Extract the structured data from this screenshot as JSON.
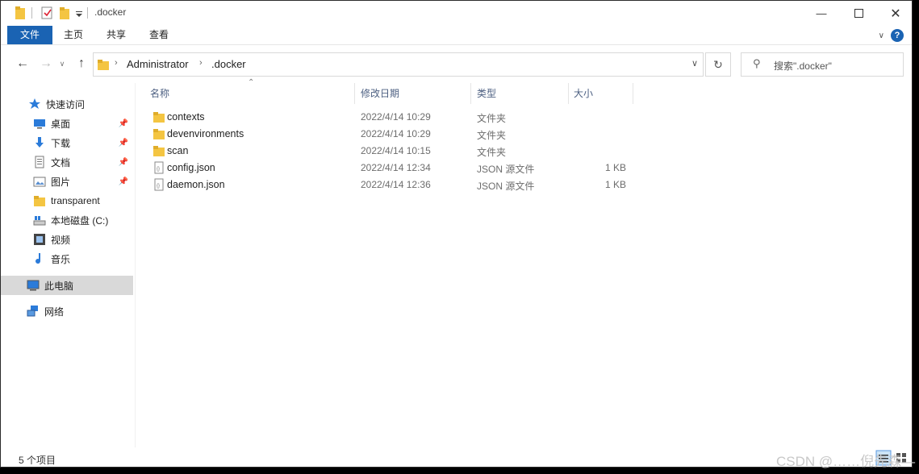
{
  "window": {
    "title": ".docker"
  },
  "ribbon": {
    "tabs": [
      "文件",
      "主页",
      "共享",
      "查看"
    ],
    "help_label": "?"
  },
  "address": {
    "segments": [
      "Administrator",
      ".docker"
    ]
  },
  "search": {
    "placeholder": "搜索\".docker\""
  },
  "sidebar": {
    "items": [
      {
        "label": "快速访问",
        "icon": "star-icon",
        "pinned": false
      },
      {
        "label": "桌面",
        "icon": "desktop-icon",
        "pinned": true
      },
      {
        "label": "下载",
        "icon": "download-icon",
        "pinned": true
      },
      {
        "label": "文档",
        "icon": "documents-icon",
        "pinned": true
      },
      {
        "label": "图片",
        "icon": "pictures-icon",
        "pinned": true
      },
      {
        "label": "transparent",
        "icon": "folder-icon",
        "pinned": false
      },
      {
        "label": "本地磁盘 (C:)",
        "icon": "drive-icon",
        "pinned": false
      },
      {
        "label": "视频",
        "icon": "video-icon",
        "pinned": false
      },
      {
        "label": "音乐",
        "icon": "music-icon",
        "pinned": false
      },
      {
        "label": "此电脑",
        "icon": "computer-icon",
        "pinned": false,
        "selected": true
      },
      {
        "label": "网络",
        "icon": "network-icon",
        "pinned": false
      }
    ]
  },
  "columns": {
    "name": "名称",
    "modified": "修改日期",
    "type": "类型",
    "size": "大小"
  },
  "files": [
    {
      "name": "contexts",
      "modified": "2022/4/14 10:29",
      "type": "文件夹",
      "size": "",
      "kind": "folder"
    },
    {
      "name": "devenvironments",
      "modified": "2022/4/14 10:29",
      "type": "文件夹",
      "size": "",
      "kind": "folder"
    },
    {
      "name": "scan",
      "modified": "2022/4/14 10:15",
      "type": "文件夹",
      "size": "",
      "kind": "folder"
    },
    {
      "name": "config.json",
      "modified": "2022/4/14 12:34",
      "type": "JSON 源文件",
      "size": "1 KB",
      "kind": "json"
    },
    {
      "name": "daemon.json",
      "modified": "2022/4/14 12:36",
      "type": "JSON 源文件",
      "size": "1 KB",
      "kind": "json"
    }
  ],
  "status": {
    "item_count": "5 个项目"
  },
  "watermark": "CSDN @……倪先森—",
  "colors": {
    "accent": "#1a63b3",
    "folder": "#f4c542",
    "selected": "#d9d9d9"
  }
}
